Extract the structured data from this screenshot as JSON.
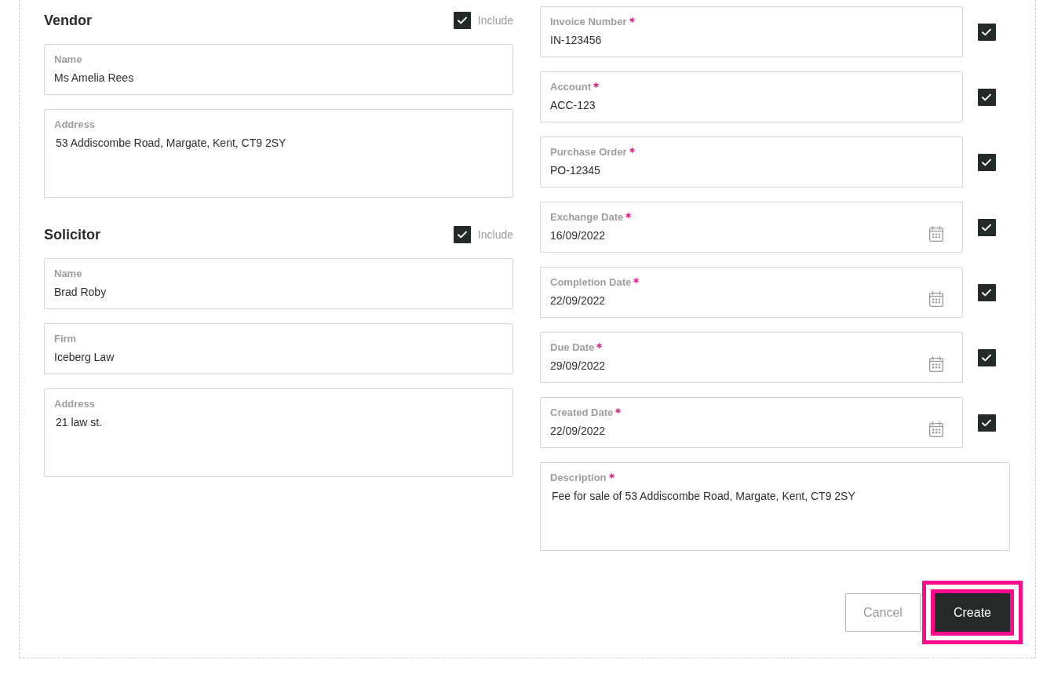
{
  "sections": [
    {
      "title": "Vendor",
      "include": {
        "label": "Include",
        "checked": true
      },
      "fields": [
        {
          "label": "Name",
          "value": "Ms Amelia Rees",
          "kind": "text"
        },
        {
          "label": "Address",
          "value": "53 Addiscombe Road, Margate, Kent, CT9 2SY",
          "kind": "textarea"
        }
      ]
    },
    {
      "title": "Solicitor",
      "include": {
        "label": "Include",
        "checked": true
      },
      "fields": [
        {
          "label": "Name",
          "value": "Brad Roby",
          "kind": "text"
        },
        {
          "label": "Firm",
          "value": "Iceberg Law",
          "kind": "text"
        },
        {
          "label": "Address",
          "value": "21 law st.",
          "kind": "textarea"
        }
      ]
    }
  ],
  "invoice_fields": [
    {
      "label": "Invoice Number",
      "value": "IN-123456",
      "kind": "text",
      "required": true,
      "checked": true
    },
    {
      "label": "Account",
      "value": "ACC-123",
      "kind": "text",
      "required": true,
      "checked": true
    },
    {
      "label": "Purchase Order",
      "value": "PO-12345",
      "kind": "text",
      "required": true,
      "checked": true
    },
    {
      "label": "Exchange Date",
      "value": "16/09/2022",
      "kind": "date",
      "required": true,
      "checked": true
    },
    {
      "label": "Completion Date",
      "value": "22/09/2022",
      "kind": "date",
      "required": true,
      "checked": true
    },
    {
      "label": "Due Date",
      "value": "29/09/2022",
      "kind": "date",
      "required": true,
      "checked": true
    },
    {
      "label": "Created Date",
      "value": "22/09/2022",
      "kind": "date",
      "required": true,
      "checked": true
    },
    {
      "label": "Description",
      "value": "Fee for sale of 53 Addiscombe Road, Margate, Kent, CT9 2SY",
      "kind": "textarea",
      "required": true
    }
  ],
  "actions": [
    {
      "label": "Cancel",
      "kind": "secondary",
      "highlighted": false
    },
    {
      "label": "Create",
      "kind": "primary",
      "highlighted": true
    }
  ]
}
